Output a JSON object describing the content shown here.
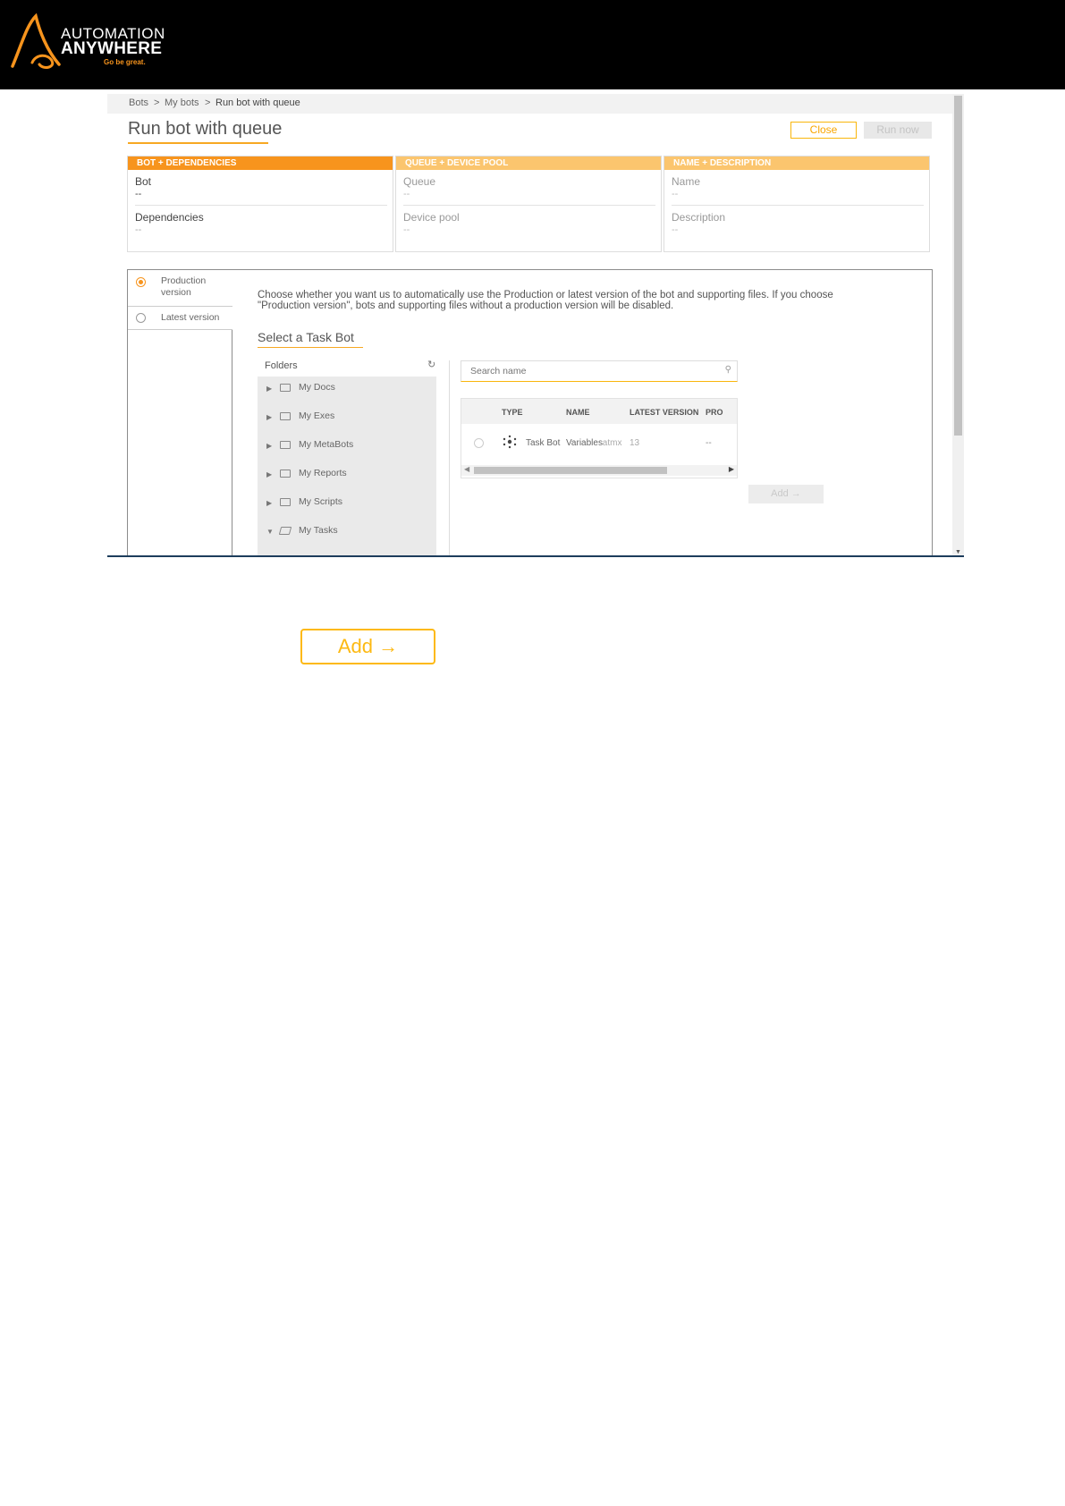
{
  "brand": {
    "line1": "AUTOMATION",
    "line2": "ANYWHERE",
    "tagline": "Go be great."
  },
  "breadcrumb": [
    "Bots",
    ">",
    "My bots",
    ">",
    "Run bot with queue"
  ],
  "page": {
    "title": "Run bot with queue",
    "close_label": "Close",
    "run_now_label": "Run now"
  },
  "panels": [
    {
      "header": "BOT + DEPENDENCIES",
      "color": "#f7941d",
      "fields": [
        {
          "label": "Bot",
          "value": "--"
        },
        {
          "label": "Dependencies",
          "value": "--"
        }
      ]
    },
    {
      "header": "QUEUE + DEVICE POOL",
      "color": "#fbc56e",
      "fields": [
        {
          "label": "Queue",
          "value": "--"
        },
        {
          "label": "Device pool",
          "value": "--"
        }
      ]
    },
    {
      "header": "NAME + DESCRIPTION",
      "color": "#fbc56e",
      "fields": [
        {
          "label": "Name",
          "value": "--"
        },
        {
          "label": "Description",
          "value": "--"
        }
      ]
    }
  ],
  "version_tabs": [
    {
      "label_line1": "Production",
      "label_line2": "version",
      "selected": true
    },
    {
      "label_line1": "Latest version",
      "label_line2": "",
      "selected": false
    }
  ],
  "description": "Choose whether you want us to automatically use the Production or latest version of the bot and supporting files. If you choose \"Production version\", bots and supporting files without a production version will be disabled.",
  "section_title": "Select a Task Bot",
  "folders": {
    "header": "Folders",
    "items": [
      {
        "name": "My Docs",
        "expanded": false
      },
      {
        "name": "My Exes",
        "expanded": false
      },
      {
        "name": "My MetaBots",
        "expanded": false
      },
      {
        "name": "My Reports",
        "expanded": false
      },
      {
        "name": "My Scripts",
        "expanded": false
      },
      {
        "name": "My Tasks",
        "expanded": true
      }
    ]
  },
  "search": {
    "placeholder": "Search name"
  },
  "table": {
    "columns": [
      "TYPE",
      "NAME",
      "LATEST VERSION",
      "PRO"
    ],
    "rows": [
      {
        "type": "Task Bot",
        "name": "Variables",
        "ext": ".atmx",
        "latest_version": "13",
        "production": "--"
      }
    ]
  },
  "add_small_label": "Add →",
  "add_big_label": "Add →"
}
